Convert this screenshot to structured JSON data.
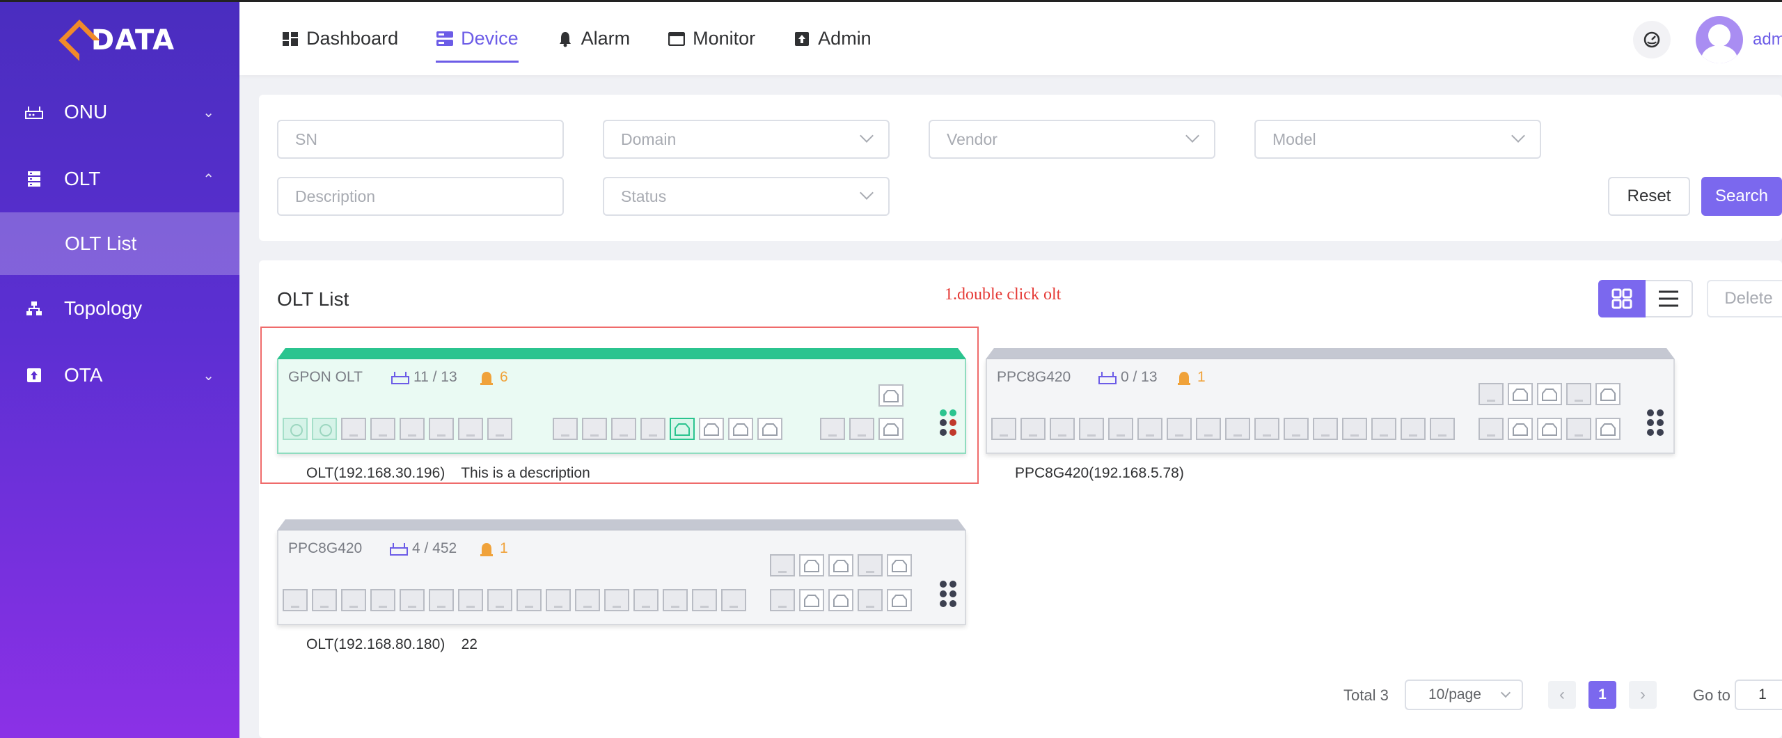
{
  "brand": {
    "logo_text": "DATA"
  },
  "sidebar": {
    "items": [
      {
        "label": "ONU",
        "icon": "onu-router-icon",
        "chevron": "down"
      },
      {
        "label": "OLT",
        "icon": "olt-server-icon",
        "chevron": "up"
      },
      {
        "label": "Topology",
        "icon": "topology-icon"
      },
      {
        "label": "OTA",
        "icon": "ota-upload-icon",
        "chevron": "down"
      }
    ],
    "sub_item": "OLT List"
  },
  "topbar": {
    "tabs": [
      {
        "label": "Dashboard",
        "icon": "dashboard-icon"
      },
      {
        "label": "Device",
        "icon": "device-icon",
        "active": true
      },
      {
        "label": "Alarm",
        "icon": "alarm-bell-icon"
      },
      {
        "label": "Monitor",
        "icon": "monitor-icon"
      },
      {
        "label": "Admin",
        "icon": "admin-icon"
      }
    ],
    "username": "adm"
  },
  "filters": {
    "sn_placeholder": "SN",
    "domain_placeholder": "Domain",
    "vendor_placeholder": "Vendor",
    "model_placeholder": "Model",
    "description_placeholder": "Description",
    "status_placeholder": "Status",
    "reset_label": "Reset",
    "search_label": "Search"
  },
  "list": {
    "title": "OLT List",
    "hint": "1.double click olt",
    "delete_label": "Delete",
    "devices": [
      {
        "name": "GPON OLT",
        "count": "11 / 13",
        "alarms": "6",
        "caption": "OLT(192.168.30.196)    This is a description",
        "status": "online"
      },
      {
        "name": "PPC8G420",
        "count": "0 / 13",
        "alarms": "1",
        "caption": "PPC8G420(192.168.5.78)",
        "status": "offline"
      },
      {
        "name": "PPC8G420",
        "count": "4 / 452",
        "alarms": "1",
        "caption": "OLT(192.168.80.180)    22",
        "status": "offline"
      }
    ]
  },
  "pagination": {
    "total": "Total 3",
    "page_size": "10/page",
    "current_page": "1",
    "goto_label": "Go to",
    "goto_value": "1"
  },
  "colors": {
    "accent": "#7b68ee",
    "online": "#2bc48f",
    "alarm": "#f0a23a",
    "hint": "#e53935"
  }
}
